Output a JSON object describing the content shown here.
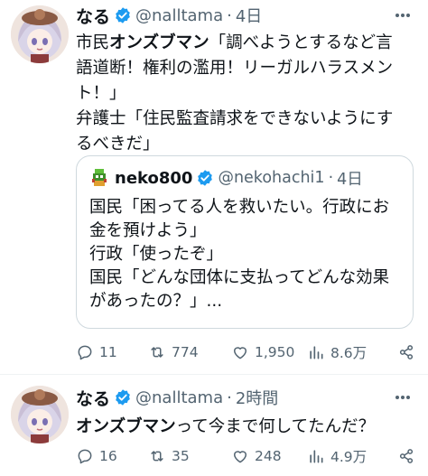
{
  "tweets": [
    {
      "display_name": "なる",
      "handle": "@nalltama",
      "separator": "·",
      "time": "4日",
      "text_lines": [
        {
          "pre": "市民",
          "bold": "オンズブマン",
          "post": "「調べようとするなど言"
        },
        {
          "pre": "語道断！権利の濫用！リーガルハラスメン",
          "bold": "",
          "post": ""
        },
        {
          "pre": "ト！」",
          "bold": "",
          "post": ""
        },
        {
          "pre": "弁護士「住民監査請求をできないようにす",
          "bold": "",
          "post": ""
        },
        {
          "pre": "るべきだ」",
          "bold": "",
          "post": ""
        }
      ],
      "quote": {
        "display_name": "neko800",
        "handle": "@nekohachi1",
        "separator": "·",
        "time": "4日",
        "text_lines": [
          "国民「困ってる人を救いたい。行政にお",
          "金を預けよう」",
          "行政「使ったぞ」",
          "国民「どんな団体に支払ってどんな効果",
          "があったの？」..."
        ]
      },
      "actions": {
        "replies": "11",
        "reposts": "774",
        "likes": "1,950",
        "views": "8.6万"
      }
    },
    {
      "display_name": "なる",
      "handle": "@nalltama",
      "separator": "·",
      "time": "2時間",
      "text_lines": [
        {
          "pre": "",
          "bold": "オンズブマン",
          "post": "って今まで何してたんだ？"
        }
      ],
      "actions": {
        "replies": "16",
        "reposts": "35",
        "likes": "248",
        "views": "4.9万"
      }
    }
  ],
  "colors": {
    "text": "#0f1419",
    "secondary": "#536471",
    "verified": "#1d9bf0",
    "border": "#cfd9de"
  },
  "icons": [
    "verified-badge-icon",
    "more-icon",
    "reply-icon",
    "repost-icon",
    "like-icon",
    "views-icon",
    "share-icon"
  ]
}
